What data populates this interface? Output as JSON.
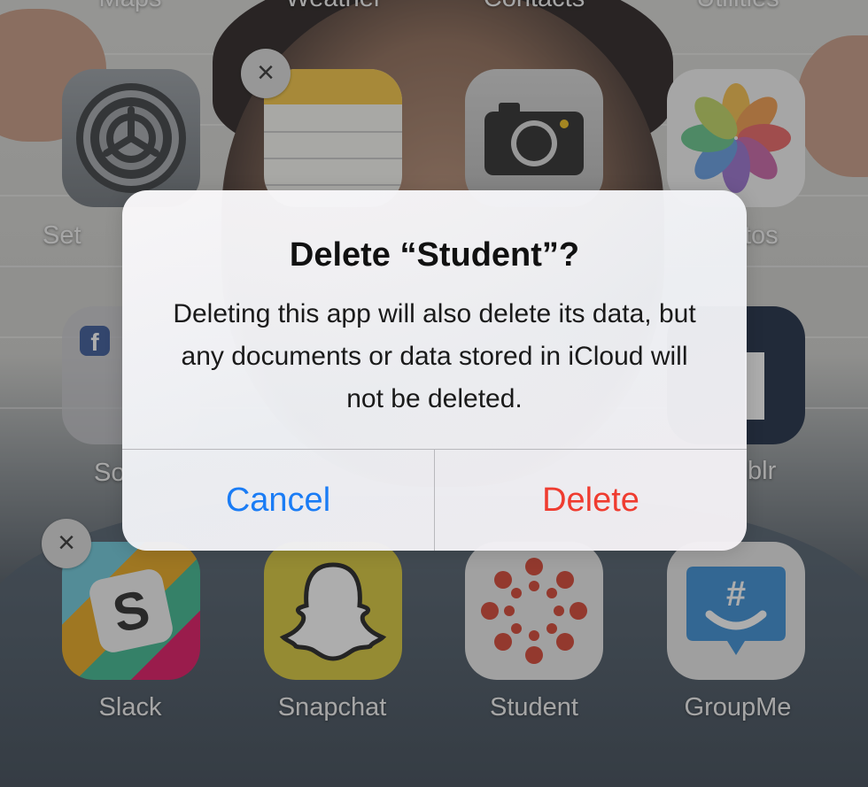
{
  "top_row_labels": [
    "Maps",
    "Weather",
    "Contacts",
    "Utilities"
  ],
  "apps": {
    "settings": {
      "label": "Set"
    },
    "notes": {
      "label": ""
    },
    "camera": {
      "label": ""
    },
    "photos": {
      "label": "tos"
    },
    "social_folder": {
      "label": "So"
    },
    "tumblr": {
      "label": "blr"
    },
    "slack": {
      "label": "Slack"
    },
    "snapchat": {
      "label": "Snapchat"
    },
    "student": {
      "label": "Student"
    },
    "groupme": {
      "label": "GroupMe"
    }
  },
  "delete_glyph": "×",
  "alert": {
    "title": "Delete “Student”?",
    "message": "Deleting this app will also delete its data, but any documents or data stored in iCloud will not be deleted.",
    "cancel_label": "Cancel",
    "delete_label": "Delete"
  },
  "colors": {
    "cancel": "#1a7cf5",
    "delete": "#ef3c30"
  }
}
